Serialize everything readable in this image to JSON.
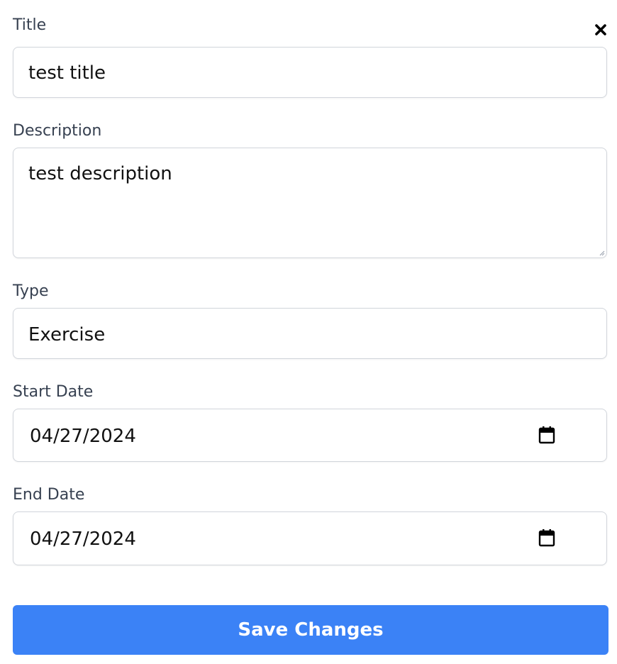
{
  "form": {
    "close_icon": "close-icon",
    "title_label": "Title",
    "title_value": "test title",
    "description_label": "Description",
    "description_value": "test description",
    "type_label": "Type",
    "type_value": "Exercise",
    "start_date_label": "Start Date",
    "start_date_value": "04/27/2024",
    "end_date_label": "End Date",
    "end_date_value": "04/27/2024",
    "calendar_icon": "calendar-icon",
    "save_label": "Save Changes"
  },
  "colors": {
    "accent": "#3b82f6",
    "label": "#374151",
    "border": "#d1d5db"
  }
}
